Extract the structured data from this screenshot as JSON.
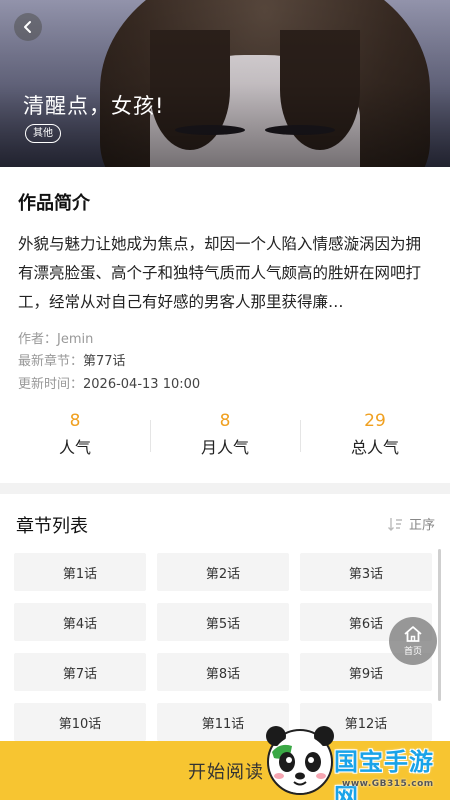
{
  "cover": {
    "title": "清醒点，女孩!",
    "tag": "其他"
  },
  "intro": {
    "heading": "作品简介",
    "description": "外貌与魅力让她成为焦点，却因一个人陷入情感漩涡因为拥有漂亮脸蛋、高个子和独特气质而人气颇高的胜妍在网吧打工，经常从对自己有好感的男客人那里获得廉…",
    "author_label": "作者：",
    "author": "Jemin",
    "latest_label": "最新章节：",
    "latest": "第77话",
    "updated_label": "更新时间：",
    "updated": "2026-04-13 10:00",
    "stats": [
      {
        "value": "8",
        "label": "人气"
      },
      {
        "value": "8",
        "label": "月人气"
      },
      {
        "value": "29",
        "label": "总人气"
      }
    ]
  },
  "chapters": {
    "heading": "章节列表",
    "sort_label": "正序",
    "items": [
      "第1话",
      "第2话",
      "第3话",
      "第4话",
      "第5话",
      "第6话",
      "第7话",
      "第8话",
      "第9话",
      "第10话",
      "第11话",
      "第12话"
    ]
  },
  "home_button": {
    "label": "首页"
  },
  "read_button": {
    "label": "开始阅读"
  },
  "watermark": {
    "brand": "国宝手游网",
    "url": "www.GB315.com"
  },
  "colors": {
    "accent": "#f7c531",
    "stat_number": "#f0a020",
    "brand": "#1aa3e8"
  }
}
